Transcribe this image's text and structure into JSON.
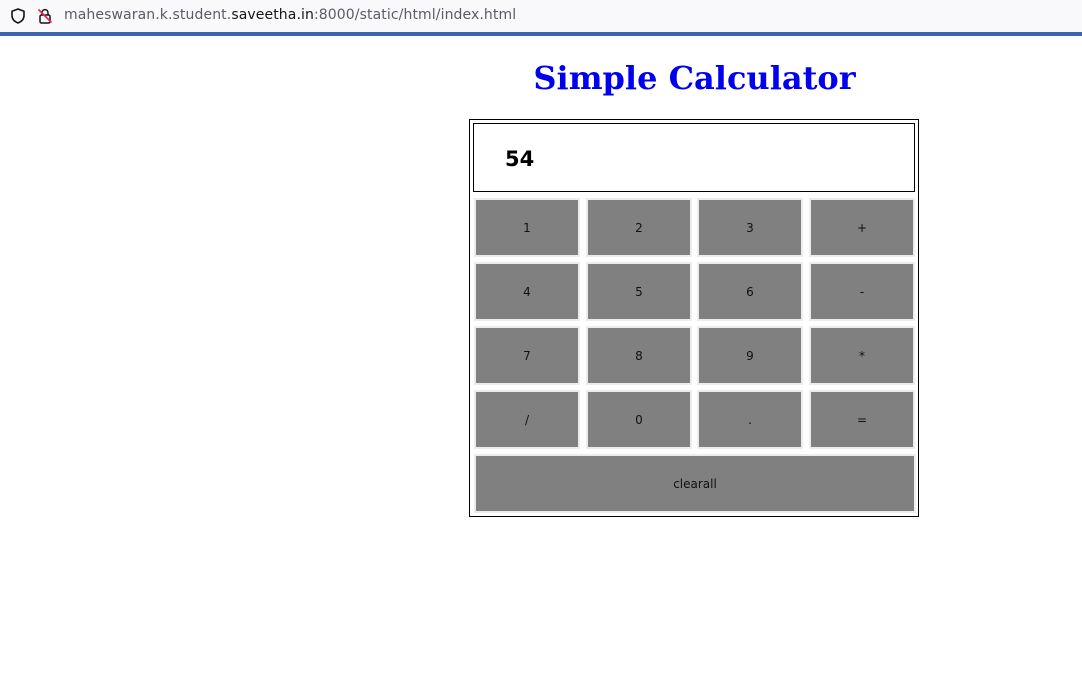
{
  "browser": {
    "url_prefix": "maheswaran.k.student.",
    "url_domain": "saveetha.in",
    "url_suffix": ":8000/static/html/index.html"
  },
  "page": {
    "title": "Simple Calculator",
    "title_color": "#0000ee"
  },
  "calculator": {
    "display_value": "54",
    "button_color": "#808080",
    "keys": [
      "1",
      "2",
      "3",
      "+",
      "4",
      "5",
      "6",
      "-",
      "7",
      "8",
      "9",
      "*",
      "/",
      "0",
      ".",
      "="
    ],
    "clear_label": "clearall"
  }
}
